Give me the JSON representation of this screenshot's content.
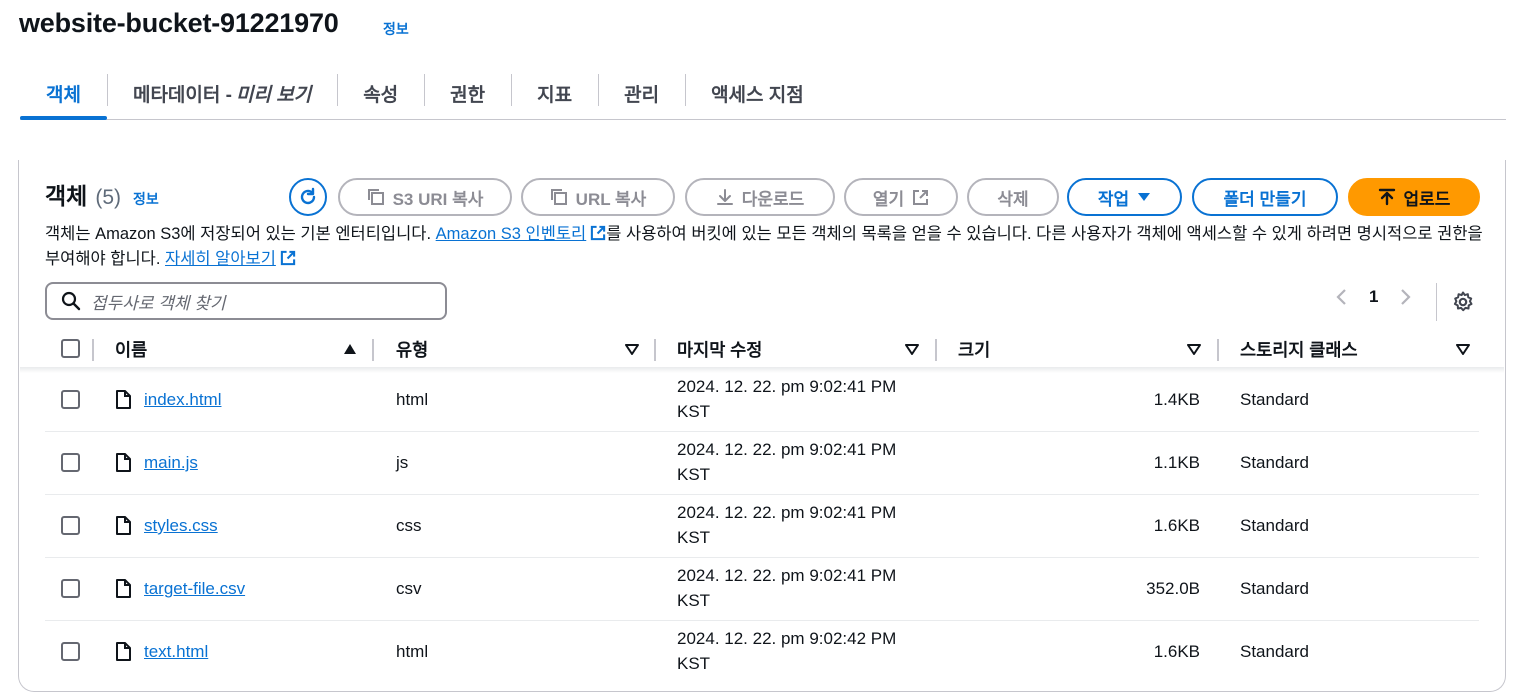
{
  "bucket": {
    "name": "website-bucket-91221970",
    "info": "정보"
  },
  "tabs": [
    {
      "label": "객체",
      "active": true
    },
    {
      "label": "메타데이터 -",
      "italic": "미리 보기"
    },
    {
      "label": "속성"
    },
    {
      "label": "권한"
    },
    {
      "label": "지표"
    },
    {
      "label": "관리"
    },
    {
      "label": "액세스 지점"
    }
  ],
  "objects": {
    "title": "객체",
    "count": "(5)",
    "info": "정보",
    "buttons": {
      "refresh_icon": "refresh-icon",
      "copy_s3_uri": "S3 URI 복사",
      "copy_url": "URL 복사",
      "download": "다운로드",
      "open": "열기",
      "delete": "삭제",
      "actions": "작업",
      "create_folder": "폴더 만들기",
      "upload": "업로드"
    },
    "desc_part1": "객체는 Amazon S3에 저장되어 있는 기본 엔터티입니다.",
    "desc_link1": "Amazon S3 인벤토리",
    "desc_part2": "를 사용하여 버킷에 있는 모든 객체의 목록을 얻을 수 있습니다. 다른 사용자가 객체에 액세스할 수 있게 하려면 명시적으로 권한을 부여해야 합니다.",
    "desc_link2": "자세히 알아보기",
    "search_placeholder": "접두사로 객체 찾기",
    "page": "1"
  },
  "table": {
    "columns": [
      "이름",
      "유형",
      "마지막 수정",
      "크기",
      "스토리지 클래스"
    ],
    "rows": [
      {
        "name": "index.html",
        "type": "html",
        "modified": "2024. 12. 22. pm 9:02:41 PM KST",
        "size": "1.4KB",
        "class": "Standard"
      },
      {
        "name": "main.js",
        "type": "js",
        "modified": "2024. 12. 22. pm 9:02:41 PM KST",
        "size": "1.1KB",
        "class": "Standard"
      },
      {
        "name": "styles.css",
        "type": "css",
        "modified": "2024. 12. 22. pm 9:02:41 PM KST",
        "size": "1.6KB",
        "class": "Standard"
      },
      {
        "name": "target-file.csv",
        "type": "csv",
        "modified": "2024. 12. 22. pm 9:02:41 PM KST",
        "size": "352.0B",
        "class": "Standard"
      },
      {
        "name": "text.html",
        "type": "html",
        "modified": "2024. 12. 22. pm 9:02:42 PM KST",
        "size": "1.6KB",
        "class": "Standard"
      }
    ]
  },
  "colors": {
    "accent": "#0972d3",
    "upload": "#ff9900",
    "border": "#c6c6cd"
  }
}
